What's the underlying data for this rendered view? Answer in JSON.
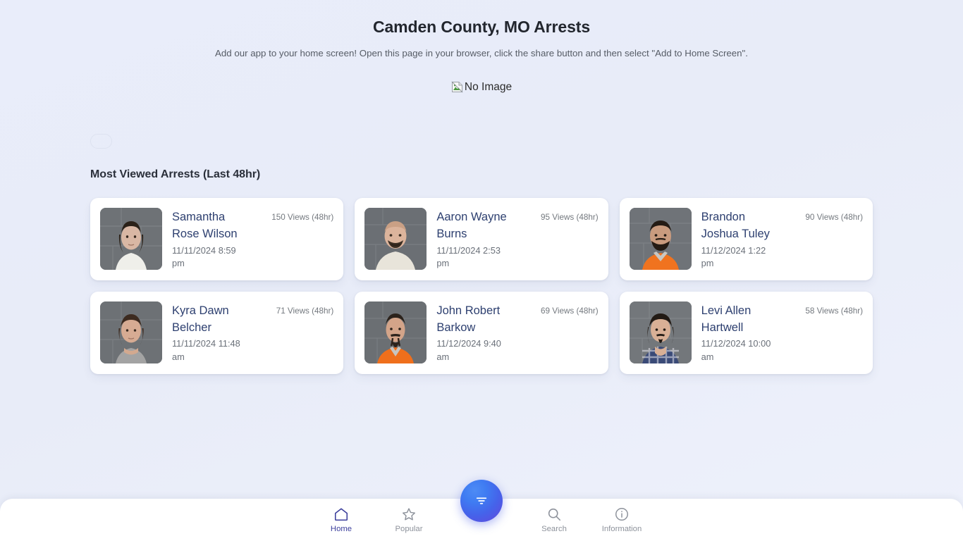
{
  "header": {
    "title": "Camden County, MO Arrests",
    "pwa_hint": "Add our app to your home screen! Open this page in your browser, click the share button and then select \"Add to Home Screen\"."
  },
  "banner": {
    "alt_text": "No Image",
    "icon": "broken-image-icon"
  },
  "section": {
    "heading": "Most Viewed Arrests (Last 48hr)"
  },
  "colors": {
    "page_background": "#e8ecf8",
    "card_background": "#ffffff",
    "name_link": "#2e4070",
    "muted_text": "#6a7079",
    "nav_active": "#3c3f9c",
    "nav_inactive": "#8d929b",
    "fab_gradient_start": "#4d8bf5",
    "fab_gradient_end": "#5b4fe0"
  },
  "arrests": [
    {
      "name": "Samantha Rose Wilson",
      "date": "11/11/2024 8:59 pm",
      "views": "150 Views (48hr)",
      "view_number": 150,
      "photo": {
        "skin": "#d9b7a4",
        "hair": "#2b2118",
        "shirt": "#efefea",
        "wall": "#6e7276"
      }
    },
    {
      "name": "Aaron Wayne Burns",
      "date": "11/11/2024 2:53 pm",
      "views": "95 Views (48hr)",
      "view_number": 95,
      "photo": {
        "skin": "#dcb49c",
        "hair": "#3a2d22",
        "shirt": "#e8e4da",
        "wall": "#6b6f74"
      }
    },
    {
      "name": "Brandon Joshua Tuley",
      "date": "11/12/2024 1:22 pm",
      "views": "90 Views (48hr)",
      "view_number": 90,
      "photo": {
        "skin": "#c99b7e",
        "hair": "#241b14",
        "shirt": "#f0731f",
        "wall": "#6f7378"
      }
    },
    {
      "name": "Kyra Dawn Belcher",
      "date": "11/11/2024 11:48 am",
      "views": "71 Views (48hr)",
      "view_number": 71,
      "photo": {
        "skin": "#d6ab93",
        "hair": "#3d2b20",
        "shirt": "#a3a3a3",
        "wall": "#6d7175"
      }
    },
    {
      "name": "John Robert Barkow",
      "date": "11/12/2024 9:40 am",
      "views": "69 Views (48hr)",
      "view_number": 69,
      "photo": {
        "skin": "#d3a489",
        "hair": "#2b221b",
        "shirt": "#ef6f1c",
        "wall": "#6b6f73"
      }
    },
    {
      "name": "Levi Allen Hartwell",
      "date": "11/12/2024 10:00 am",
      "views": "58 Views (48hr)",
      "view_number": 58,
      "photo": {
        "skin": "#d9b096",
        "hair": "#221a14",
        "shirt": "#3a4a77",
        "wall": "#73777b"
      }
    }
  ],
  "bottom_nav": {
    "items": [
      {
        "label": "Home",
        "icon": "home-icon",
        "active": true
      },
      {
        "label": "Popular",
        "icon": "star-icon",
        "active": false
      },
      {
        "label": "Search",
        "icon": "search-icon",
        "active": false
      },
      {
        "label": "Information",
        "icon": "info-icon",
        "active": false
      }
    ],
    "fab": {
      "icon": "filter-funnel-icon",
      "label": ""
    }
  }
}
